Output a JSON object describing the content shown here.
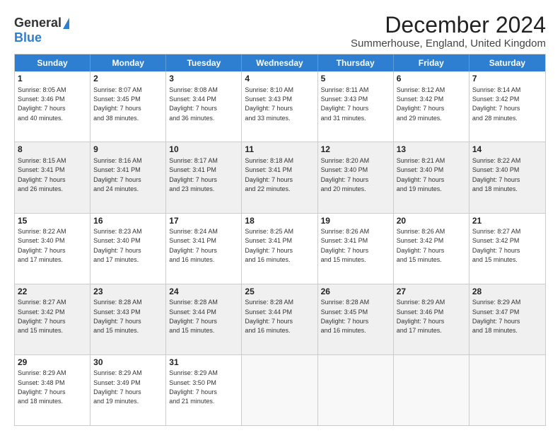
{
  "logo": {
    "general": "General",
    "blue": "Blue"
  },
  "title": "December 2024",
  "subtitle": "Summerhouse, England, United Kingdom",
  "header_days": [
    "Sunday",
    "Monday",
    "Tuesday",
    "Wednesday",
    "Thursday",
    "Friday",
    "Saturday"
  ],
  "rows": [
    [
      {
        "day": "1",
        "text": "Sunrise: 8:05 AM\nSunset: 3:46 PM\nDaylight: 7 hours\nand 40 minutes."
      },
      {
        "day": "2",
        "text": "Sunrise: 8:07 AM\nSunset: 3:45 PM\nDaylight: 7 hours\nand 38 minutes."
      },
      {
        "day": "3",
        "text": "Sunrise: 8:08 AM\nSunset: 3:44 PM\nDaylight: 7 hours\nand 36 minutes."
      },
      {
        "day": "4",
        "text": "Sunrise: 8:10 AM\nSunset: 3:43 PM\nDaylight: 7 hours\nand 33 minutes."
      },
      {
        "day": "5",
        "text": "Sunrise: 8:11 AM\nSunset: 3:43 PM\nDaylight: 7 hours\nand 31 minutes."
      },
      {
        "day": "6",
        "text": "Sunrise: 8:12 AM\nSunset: 3:42 PM\nDaylight: 7 hours\nand 29 minutes."
      },
      {
        "day": "7",
        "text": "Sunrise: 8:14 AM\nSunset: 3:42 PM\nDaylight: 7 hours\nand 28 minutes."
      }
    ],
    [
      {
        "day": "8",
        "text": "Sunrise: 8:15 AM\nSunset: 3:41 PM\nDaylight: 7 hours\nand 26 minutes."
      },
      {
        "day": "9",
        "text": "Sunrise: 8:16 AM\nSunset: 3:41 PM\nDaylight: 7 hours\nand 24 minutes."
      },
      {
        "day": "10",
        "text": "Sunrise: 8:17 AM\nSunset: 3:41 PM\nDaylight: 7 hours\nand 23 minutes."
      },
      {
        "day": "11",
        "text": "Sunrise: 8:18 AM\nSunset: 3:41 PM\nDaylight: 7 hours\nand 22 minutes."
      },
      {
        "day": "12",
        "text": "Sunrise: 8:20 AM\nSunset: 3:40 PM\nDaylight: 7 hours\nand 20 minutes."
      },
      {
        "day": "13",
        "text": "Sunrise: 8:21 AM\nSunset: 3:40 PM\nDaylight: 7 hours\nand 19 minutes."
      },
      {
        "day": "14",
        "text": "Sunrise: 8:22 AM\nSunset: 3:40 PM\nDaylight: 7 hours\nand 18 minutes."
      }
    ],
    [
      {
        "day": "15",
        "text": "Sunrise: 8:22 AM\nSunset: 3:40 PM\nDaylight: 7 hours\nand 17 minutes."
      },
      {
        "day": "16",
        "text": "Sunrise: 8:23 AM\nSunset: 3:40 PM\nDaylight: 7 hours\nand 17 minutes."
      },
      {
        "day": "17",
        "text": "Sunrise: 8:24 AM\nSunset: 3:41 PM\nDaylight: 7 hours\nand 16 minutes."
      },
      {
        "day": "18",
        "text": "Sunrise: 8:25 AM\nSunset: 3:41 PM\nDaylight: 7 hours\nand 16 minutes."
      },
      {
        "day": "19",
        "text": "Sunrise: 8:26 AM\nSunset: 3:41 PM\nDaylight: 7 hours\nand 15 minutes."
      },
      {
        "day": "20",
        "text": "Sunrise: 8:26 AM\nSunset: 3:42 PM\nDaylight: 7 hours\nand 15 minutes."
      },
      {
        "day": "21",
        "text": "Sunrise: 8:27 AM\nSunset: 3:42 PM\nDaylight: 7 hours\nand 15 minutes."
      }
    ],
    [
      {
        "day": "22",
        "text": "Sunrise: 8:27 AM\nSunset: 3:42 PM\nDaylight: 7 hours\nand 15 minutes."
      },
      {
        "day": "23",
        "text": "Sunrise: 8:28 AM\nSunset: 3:43 PM\nDaylight: 7 hours\nand 15 minutes."
      },
      {
        "day": "24",
        "text": "Sunrise: 8:28 AM\nSunset: 3:44 PM\nDaylight: 7 hours\nand 15 minutes."
      },
      {
        "day": "25",
        "text": "Sunrise: 8:28 AM\nSunset: 3:44 PM\nDaylight: 7 hours\nand 16 minutes."
      },
      {
        "day": "26",
        "text": "Sunrise: 8:28 AM\nSunset: 3:45 PM\nDaylight: 7 hours\nand 16 minutes."
      },
      {
        "day": "27",
        "text": "Sunrise: 8:29 AM\nSunset: 3:46 PM\nDaylight: 7 hours\nand 17 minutes."
      },
      {
        "day": "28",
        "text": "Sunrise: 8:29 AM\nSunset: 3:47 PM\nDaylight: 7 hours\nand 18 minutes."
      }
    ],
    [
      {
        "day": "29",
        "text": "Sunrise: 8:29 AM\nSunset: 3:48 PM\nDaylight: 7 hours\nand 18 minutes."
      },
      {
        "day": "30",
        "text": "Sunrise: 8:29 AM\nSunset: 3:49 PM\nDaylight: 7 hours\nand 19 minutes."
      },
      {
        "day": "31",
        "text": "Sunrise: 8:29 AM\nSunset: 3:50 PM\nDaylight: 7 hours\nand 21 minutes."
      },
      {
        "day": "",
        "text": ""
      },
      {
        "day": "",
        "text": ""
      },
      {
        "day": "",
        "text": ""
      },
      {
        "day": "",
        "text": ""
      }
    ]
  ]
}
